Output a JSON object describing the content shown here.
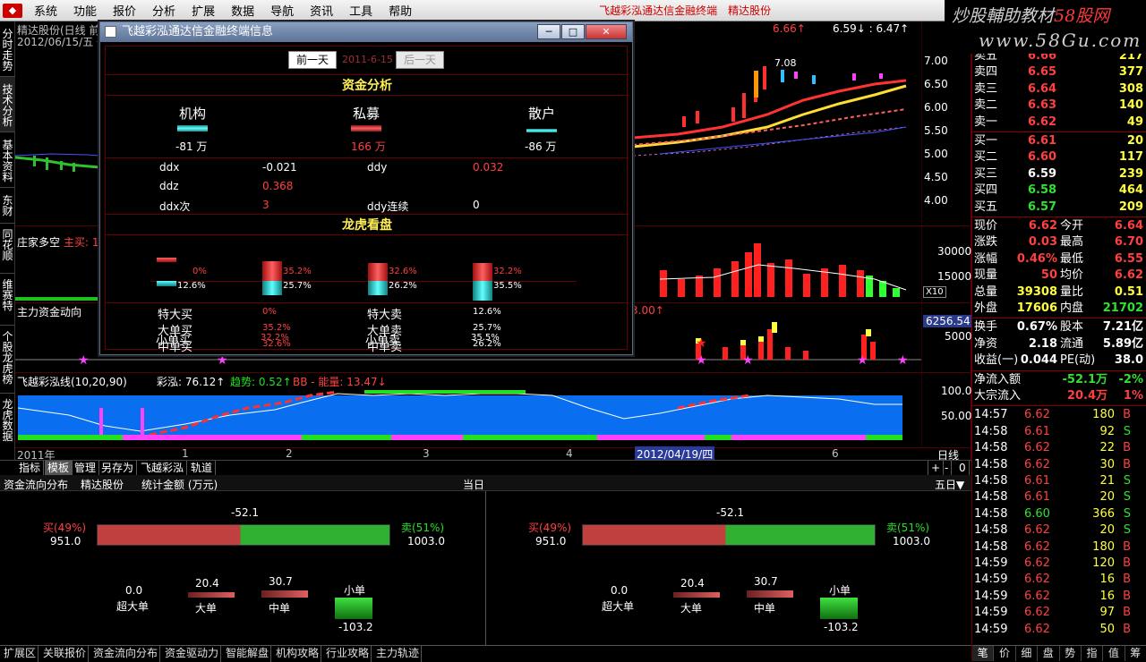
{
  "menu": {
    "items": [
      "系统",
      "功能",
      "报价",
      "分析",
      "扩展",
      "数据",
      "导航",
      "资讯",
      "工具",
      "帮助"
    ],
    "brand": "飞越彩泓通达信金融终端",
    "brand2": "精达股份"
  },
  "watermark": {
    "line1a": "炒股輔助教材",
    "line1b": "58股网",
    "line2": "www.58Gu.com"
  },
  "lefttabs": [
    "分时走势",
    "技术分析",
    "基本资料",
    "东财",
    "同花顺",
    "维赛特",
    "个股龙虎榜",
    "龙虎数据"
  ],
  "chart": {
    "header1": "精达股份(日线 前",
    "header2": "2012/06/15/五 开",
    "yaxis": [
      "7.00",
      "6.50",
      "6.00",
      "5.50",
      "5.00",
      "4.50",
      "4.00"
    ],
    "topinfo": "6.59↓ : 6.47↑",
    "topinfo_left": "6.66↑",
    "peak_label": "7.08",
    "vol_label": "庄家多空",
    "vol_label2": "主买: 1",
    "vol_axis": [
      "30000",
      "15000"
    ],
    "vol_x": "X10",
    "flow_label": "主力资金动向",
    "flow_val": "3.00↑",
    "flow_axis": [
      "6256.54",
      "5000"
    ],
    "ind_label": "飞越彩泓线(10,20,90)",
    "ind_cai": "彩泓: 76.12↑",
    "ind_trend": "趋势: 0.52↑",
    "ind_bb": "BB - 能量: 13.47↓",
    "ind_axis": [
      "100.00",
      "50.00"
    ],
    "xaxis": [
      "2011年",
      "1",
      "2",
      "3",
      "4",
      "2012/04/19/四",
      "6"
    ],
    "period": "日线"
  },
  "dialog": {
    "title": "飞越彩泓通达信金融终端信息",
    "prev": "前一天",
    "date": "2011-6-15",
    "next": "后一天",
    "sec1": "资金分析",
    "groups": [
      {
        "name": "机构",
        "val": "-81 万"
      },
      {
        "name": "私募",
        "val": "166 万"
      },
      {
        "name": "散户",
        "val": "-86 万"
      }
    ],
    "ddx_label": "ddx",
    "ddx": "-0.021",
    "ddy_label": "ddy",
    "ddy": "0.032",
    "ddz_label": "ddz",
    "ddz": "0.368",
    "ddxn_label": "ddx次",
    "ddxn": "3",
    "ddyl_label": "ddy连续",
    "ddyl": "0",
    "sec2": "龙虎看盘",
    "bars": [
      {
        "top": "0%",
        "bot": "12.6%"
      },
      {
        "top": "35.2%",
        "bot": "25.7%"
      },
      {
        "top": "32.6%",
        "bot": "26.2%"
      },
      {
        "top": "32.2%",
        "bot": "35.5%"
      }
    ],
    "rows": [
      [
        "特大买",
        "0%",
        "特大卖",
        "12.6%"
      ],
      [
        "大单买",
        "35.2%",
        "大单卖",
        "25.7%"
      ],
      [
        "中单买",
        "32.6%",
        "中单卖",
        "26.2%"
      ],
      [
        "小单买",
        "32.2%",
        "小单卖",
        "35.5%"
      ]
    ]
  },
  "bottombar": [
    "指标",
    "模板",
    "管理",
    "另存为",
    "飞越彩泓",
    "轨道"
  ],
  "bottomright": [
    "+",
    "-",
    "0"
  ],
  "flow": {
    "title": "资金流向分布",
    "stock": "精达股份",
    "unit": "统计金额 (万元)",
    "period1": "当日",
    "period2": "五日▼",
    "panels": [
      {
        "net": "-52.1",
        "buy_pct": "买(49%)",
        "buy_val": "951.0",
        "sell_pct": "卖(51%)",
        "sell_val": "1003.0",
        "buy_frac": 0.49,
        "items": [
          {
            "label": "超大单",
            "val": "0.0"
          },
          {
            "label": "大单",
            "val": "20.4"
          },
          {
            "label": "中单",
            "val": "30.7"
          },
          {
            "label": "小单",
            "val": "-103.2"
          }
        ]
      },
      {
        "net": "-52.1",
        "buy_pct": "买(49%)",
        "buy_val": "951.0",
        "sell_pct": "卖(51%)",
        "sell_val": "1003.0",
        "buy_frac": 0.49,
        "items": [
          {
            "label": "超大单",
            "val": "0.0"
          },
          {
            "label": "大单",
            "val": "20.4"
          },
          {
            "label": "中单",
            "val": "30.7"
          },
          {
            "label": "小单",
            "val": "-103.2"
          }
        ]
      }
    ]
  },
  "taskbar": [
    "扩展区",
    "关联报价",
    "资金流向分布",
    "资金驱动力",
    "智能解盘",
    "机构攻略",
    "行业攻略",
    "主力轨迹"
  ],
  "quote": {
    "asks": [
      [
        "卖五",
        "6.66",
        "217"
      ],
      [
        "卖四",
        "6.65",
        "377"
      ],
      [
        "卖三",
        "6.64",
        "308"
      ],
      [
        "卖二",
        "6.63",
        "140"
      ],
      [
        "卖一",
        "6.62",
        "49"
      ]
    ],
    "bids": [
      [
        "买一",
        "6.61",
        "20"
      ],
      [
        "买二",
        "6.60",
        "117"
      ],
      [
        "买三",
        "6.59",
        "239"
      ],
      [
        "买四",
        "6.58",
        "464"
      ],
      [
        "买五",
        "6.57",
        "209"
      ]
    ],
    "stats": [
      [
        "现价",
        "6.62",
        "今开",
        "6.64"
      ],
      [
        "涨跌",
        "0.03",
        "最高",
        "6.70"
      ],
      [
        "涨幅",
        "0.46%",
        "最低",
        "6.55"
      ],
      [
        "现量",
        "50",
        "均价",
        "6.62"
      ],
      [
        "总量",
        "39308",
        "量比",
        "0.51"
      ],
      [
        "外盘",
        "17606",
        "内盘",
        "21702"
      ]
    ],
    "stats2": [
      [
        "换手",
        "0.67%",
        "股本",
        "7.21亿"
      ],
      [
        "净资",
        "2.18",
        "流通",
        "5.89亿"
      ],
      [
        "收益(一)",
        "0.044",
        "PE(动)",
        "38.0"
      ]
    ],
    "flowin": [
      [
        "净流入额",
        "-52.1万",
        "-2%"
      ],
      [
        "大宗流入",
        "20.4万",
        "1%"
      ]
    ],
    "ticks": [
      [
        "14:57",
        "6.62",
        "180",
        "B"
      ],
      [
        "14:58",
        "6.61",
        "92",
        "S"
      ],
      [
        "14:58",
        "6.62",
        "22",
        "B"
      ],
      [
        "14:58",
        "6.62",
        "30",
        "B"
      ],
      [
        "14:58",
        "6.61",
        "21",
        "S"
      ],
      [
        "14:58",
        "6.61",
        "20",
        "S"
      ],
      [
        "14:58",
        "6.60",
        "366",
        "S"
      ],
      [
        "14:58",
        "6.62",
        "20",
        "S"
      ],
      [
        "14:58",
        "6.62",
        "180",
        "B"
      ],
      [
        "14:59",
        "6.62",
        "120",
        "B"
      ],
      [
        "14:59",
        "6.62",
        "16",
        "B"
      ],
      [
        "14:59",
        "6.62",
        "16",
        "B"
      ],
      [
        "14:59",
        "6.62",
        "97",
        "B"
      ],
      [
        "14:59",
        "6.62",
        "50",
        "B"
      ]
    ],
    "tabs": [
      "笔",
      "价",
      "细",
      "盘",
      "势",
      "指",
      "值",
      "筹"
    ]
  }
}
